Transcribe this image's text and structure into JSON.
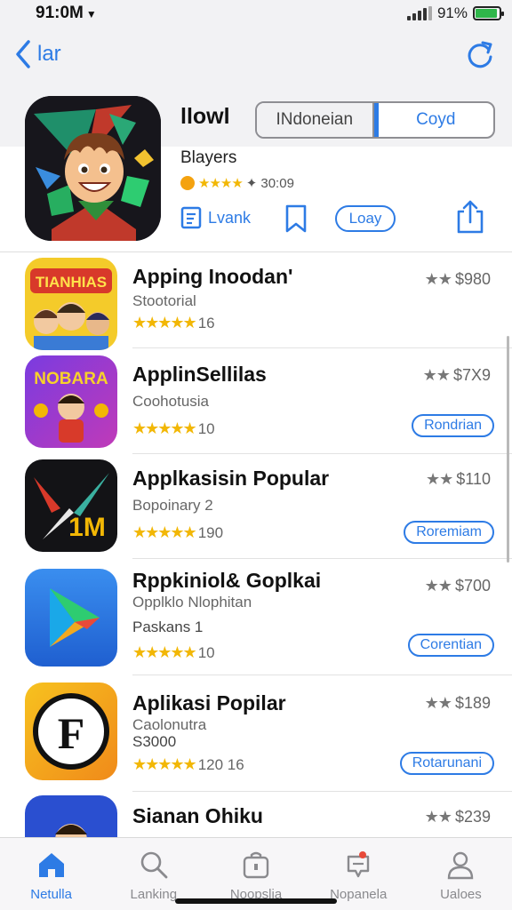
{
  "status": {
    "time": "91:0M",
    "battery_text": "91%",
    "battery_level": 0.91
  },
  "nav": {
    "back_label": "lar",
    "refresh_icon": "refresh-icon"
  },
  "hero": {
    "title": "llowl",
    "segments": [
      "INdoneian",
      "Coyd"
    ],
    "selected_segment": "Coyd",
    "subtitle": "Blayers",
    "rating_text": "30:09",
    "actions": {
      "lvank_label": "Lvank",
      "loay_label": "Loay"
    }
  },
  "apps": [
    {
      "title": "Apping Inoodan'",
      "subtitle": "Stootorial",
      "extra": "",
      "rating_count": "16",
      "price": "$980",
      "button": ""
    },
    {
      "title": "ApplinSellilas",
      "subtitle": "Coohotusia",
      "extra": "",
      "rating_count": "10",
      "price": "$7X9",
      "button": "Rondrian"
    },
    {
      "title": "Applkasisin Popular",
      "subtitle": "Bopoinary 2",
      "extra": "",
      "rating_count": "190",
      "price": "$110",
      "button": "Roremiam"
    },
    {
      "title": "Rppkiniol& Goplkai",
      "subtitle": "Opplklo Nlophitan",
      "extra": "Paskans 1",
      "rating_count": "10",
      "price": "$700",
      "button": "Corentian"
    },
    {
      "title": "Aplikasi Popilar",
      "subtitle": "Caolonutra",
      "extra": "S3000",
      "rating_count": "120 16",
      "price": "$189",
      "button": "Rotarunani"
    },
    {
      "title": "Sianan Ohiku",
      "subtitle": "",
      "extra": "",
      "rating_count": "",
      "price": "$239",
      "button": ""
    }
  ],
  "tabs": [
    {
      "label": "Netulla",
      "icon": "home-icon",
      "active": true
    },
    {
      "label": "Lanking",
      "icon": "search-icon",
      "active": false
    },
    {
      "label": "Noopslia",
      "icon": "bag-icon",
      "active": false
    },
    {
      "label": "Nopanela",
      "icon": "tag-icon",
      "active": false
    },
    {
      "label": "Ualoes",
      "icon": "person-icon",
      "active": false
    }
  ],
  "colors": {
    "accent": "#2d7be5",
    "star": "#f2b705",
    "background": "#ffffff",
    "header": "#f2f2f4"
  }
}
